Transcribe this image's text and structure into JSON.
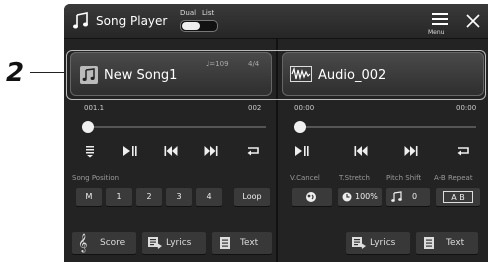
{
  "callout": {
    "number": "2"
  },
  "header": {
    "title": "Song Player",
    "dual_label": "Dual",
    "list_label": "List",
    "menu_label": "Menu"
  },
  "song_a": {
    "tempo": "♩=109",
    "time_sig": "4/4",
    "name": "New Song1",
    "position_start": "001.1",
    "position_end": "002",
    "section_label": "Song Position",
    "position_buttons": [
      "M",
      "1",
      "2",
      "3",
      "4",
      "Loop"
    ],
    "bottom_buttons": {
      "score": "Score",
      "lyrics": "Lyrics",
      "text": "Text"
    }
  },
  "song_b": {
    "name": "Audio_002",
    "time_start": "00:00",
    "time_end": "00:00",
    "vcancel_label": "V.Cancel",
    "tstretch_label": "T.Stretch",
    "pitch_label": "Pitch Shift",
    "ab_label": "A-B Repeat",
    "tstretch_value": "100%",
    "pitch_value": "0",
    "ab_value": "A B",
    "bottom_buttons": {
      "lyrics": "Lyrics",
      "text": "Text"
    }
  },
  "colors": {
    "screen_bg": "#1e1e1e",
    "pane_bg": "#232323",
    "knob": "#f0f0f0"
  }
}
